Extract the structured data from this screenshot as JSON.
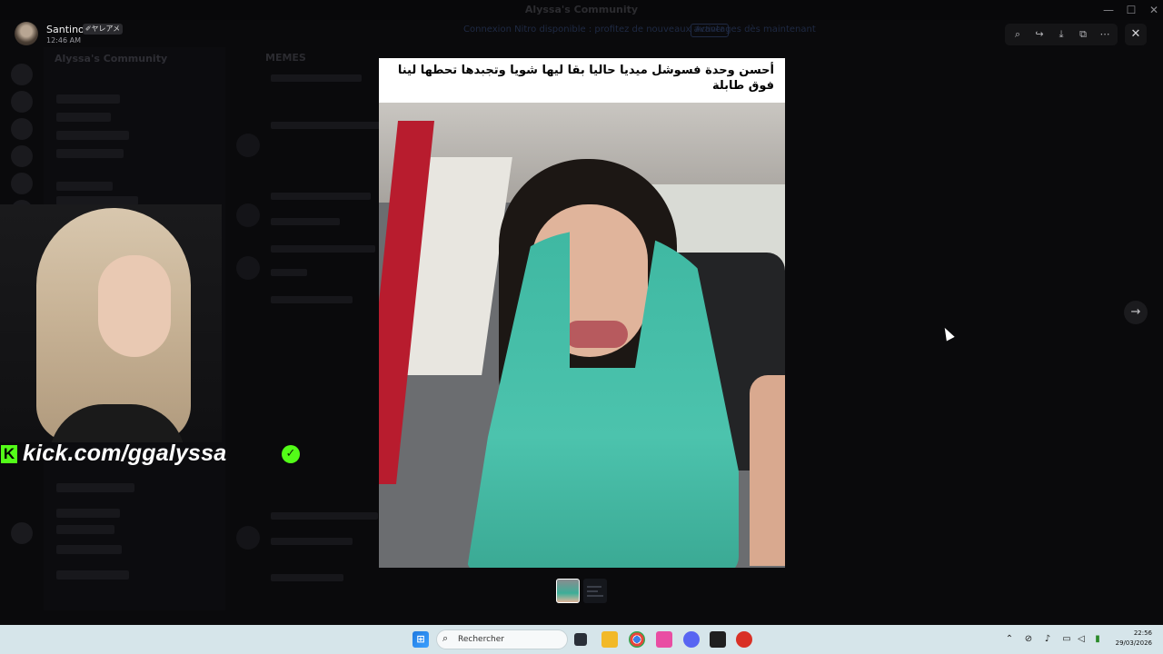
{
  "window": {
    "title": "Alyssa's Community",
    "minimize": "—",
    "maximize": "☐",
    "close": "✕"
  },
  "banner": {
    "text": "Connexion Nitro disponible : profitez de nouveaux avantages dès maintenant",
    "button": "Activer"
  },
  "background": {
    "server_name": "Alyssa's Community",
    "channel": "MEMES"
  },
  "viewer": {
    "author": "Santino",
    "author_tag": "✐ヤレアメ",
    "timestamp": "12:46 AM",
    "caption": "أحسن وحدة فسوشل ميديا حاليا بقا ليها شويا وتجبدها تحطها لينا فوق طابلة",
    "tools": {
      "zoom": "⌕",
      "forward": "↪",
      "download": "⤓",
      "open_external": "⧉",
      "more": "⋯"
    },
    "close_label": "✕",
    "prev_label": "←",
    "next_label": "→"
  },
  "stream_overlay": {
    "k_logo": "K",
    "url": "kick.com/ggalyssa",
    "verified": "✓"
  },
  "taskbar": {
    "start_label": "⊞",
    "search_placeholder": "Rechercher",
    "search_icon": "⌕",
    "time": "22:56",
    "date": "29/03/2026",
    "accent": "#1f7ae0"
  }
}
